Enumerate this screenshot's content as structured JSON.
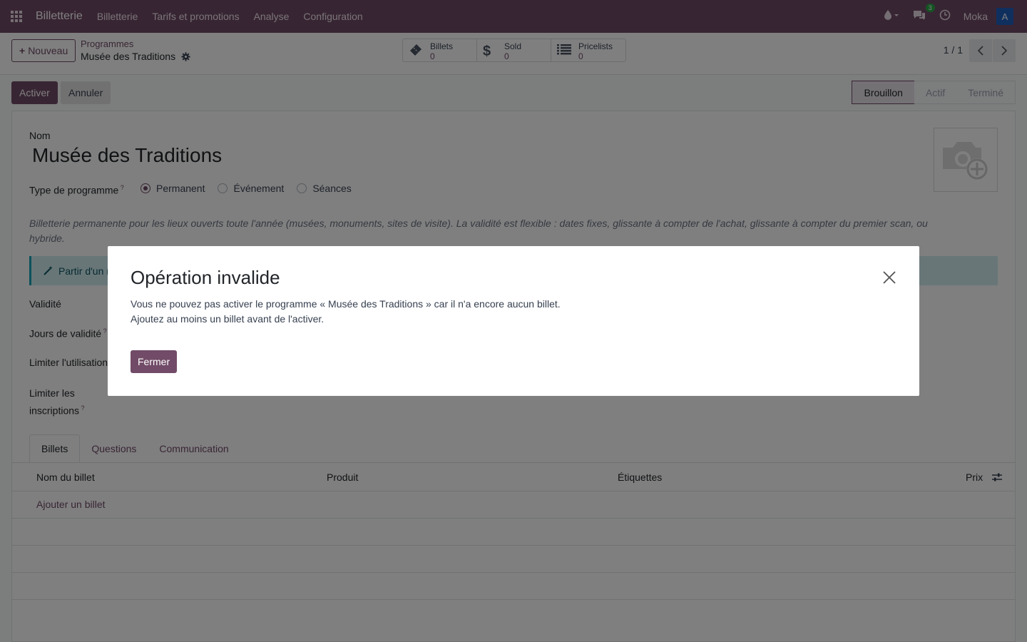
{
  "navbar": {
    "app_name": "Billetterie",
    "menu": [
      "Billetterie",
      "Tarifs et promotions",
      "Analyse",
      "Configuration"
    ],
    "messages_badge": "3",
    "company": "Moka",
    "avatar_letter": "A"
  },
  "control": {
    "new_label": "Nouveau",
    "breadcrumb_parent": "Programmes",
    "breadcrumb_current": "Musée des Traditions",
    "smart_buttons": [
      {
        "label": "Billets",
        "value": "0",
        "icon": "ticket-icon"
      },
      {
        "label": "Sold",
        "value": "0",
        "icon": "dollar-icon"
      },
      {
        "label": "Pricelists",
        "value": "0",
        "icon": "list-icon"
      }
    ],
    "pager": "1 / 1"
  },
  "statusbar": {
    "activate_label": "Activer",
    "cancel_label": "Annuler",
    "stages": [
      "Brouillon",
      "Actif",
      "Terminé"
    ],
    "active_stage": "Brouillon"
  },
  "form": {
    "name_label": "Nom",
    "name_value": "Musée des Traditions",
    "type_label": "Type de programme",
    "type_options": [
      "Permanent",
      "Événement",
      "Séances"
    ],
    "type_selected": "Permanent",
    "description": "Billetterie permanente pour les lieux ouverts toute l'année (musées, monuments, sites de visite). La validité est flexible : dates fixes, glissante à compter de l'achat, glissante à compter du premier scan, ou hybride.",
    "alert_text": "Partir d'un m",
    "fields": {
      "validite": "Validité",
      "jours_validite": "Jours de validité",
      "limiter_utilisation": "Limiter l'utilisation",
      "limiter_inscriptions_1": "Limiter les",
      "limiter_inscriptions_2": "inscriptions"
    },
    "tabs": [
      "Billets",
      "Questions",
      "Communication"
    ],
    "active_tab": "Billets",
    "table_headers": [
      "Nom du billet",
      "Produit",
      "Étiquettes",
      "Prix"
    ],
    "add_line": "Ajouter un billet"
  },
  "dialog": {
    "title": "Opération invalide",
    "line1": "Vous ne pouvez pas activer le programme « Musée des Traditions » car il n'a encore aucun billet.",
    "line2": "Ajoutez au moins un billet avant de l'activer.",
    "close_label": "Fermer"
  },
  "colors": {
    "brand": "#714b67",
    "navbar": "#714b67",
    "overlay": "rgba(0,0,0,0.5)"
  }
}
